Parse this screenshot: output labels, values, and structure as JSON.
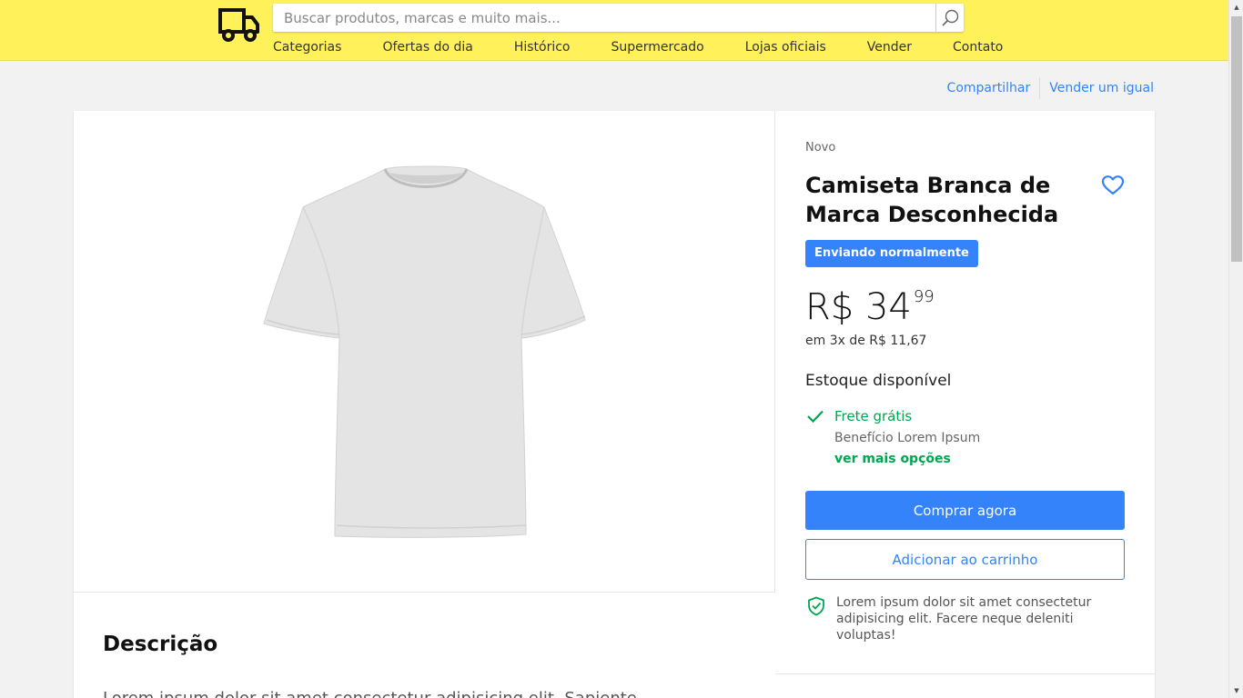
{
  "header": {
    "search_placeholder": "Buscar produtos, marcas e muito mais...",
    "nav": [
      "Categorias",
      "Ofertas do dia",
      "Histórico",
      "Supermercado",
      "Lojas oficiais",
      "Vender",
      "Contato"
    ],
    "brand_color": "#fff159"
  },
  "actions": {
    "share": "Compartilhar",
    "sell_similar": "Vender um igual"
  },
  "product": {
    "condition": "Novo",
    "title": "Camiseta Branca de Marca Desconhecida",
    "shipping_badge": "Enviando normalmente",
    "price_main": "R$ 34",
    "price_cents": "99",
    "installments": "em 3x de R$ 11,67",
    "stock": "Estoque disponível",
    "shipping_title": "Frete grátis",
    "shipping_sub": "Benefício Lorem Ipsum",
    "shipping_more": "ver mais opções",
    "buy_now": "Comprar agora",
    "add_to_cart": "Adicionar ao carrinho",
    "guarantee": "Lorem ipsum dolor sit amet consectetur adipisicing elit. Facere neque deleniti voluptas!",
    "image_icon": "tshirt-image"
  },
  "description": {
    "title": "Descrição",
    "text": "Lorem ipsum dolor sit amet consectetur adipisicing elit. Sapiente"
  },
  "colors": {
    "accent": "#3483fa",
    "success": "#00a650"
  }
}
